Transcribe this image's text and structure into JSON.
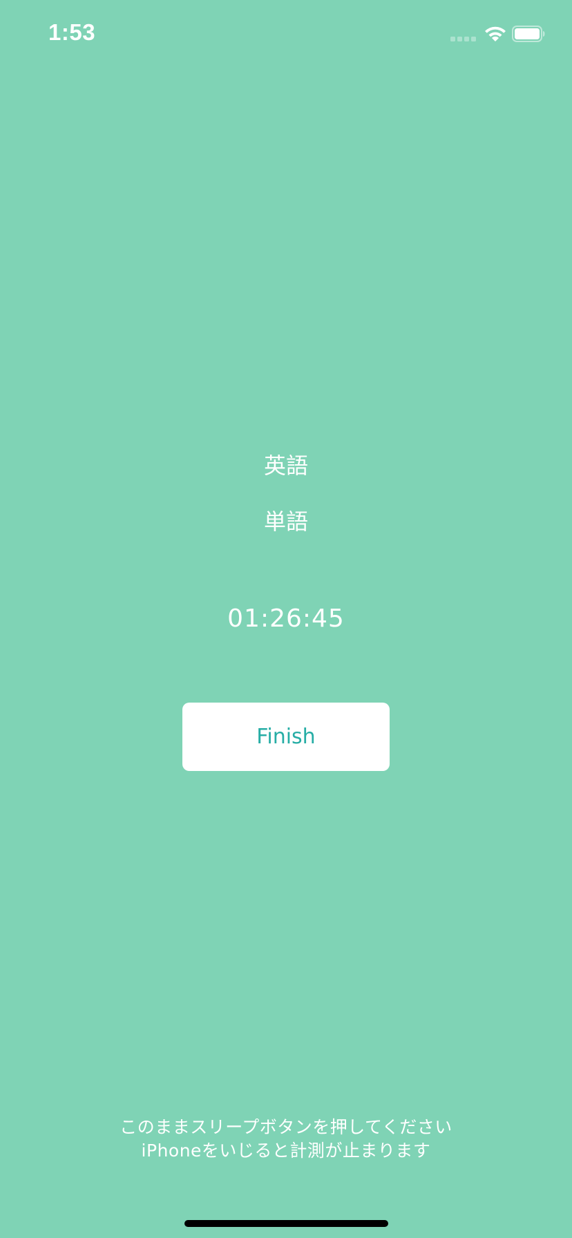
{
  "status_bar": {
    "time": "1:53",
    "icons": [
      "signal-icon",
      "wifi-icon",
      "battery-icon"
    ]
  },
  "session": {
    "subject": "英語",
    "topic": "単語",
    "elapsed": "01:26:45"
  },
  "actions": {
    "finish_label": "Finish"
  },
  "note": {
    "line1": "このままスリープボタンを押してください",
    "line2": "iPhoneをいじると計測が止まります"
  },
  "colors": {
    "background": "#7fd3b5",
    "text": "#ffffff",
    "button_background": "#ffffff",
    "button_text": "#26ada5"
  }
}
